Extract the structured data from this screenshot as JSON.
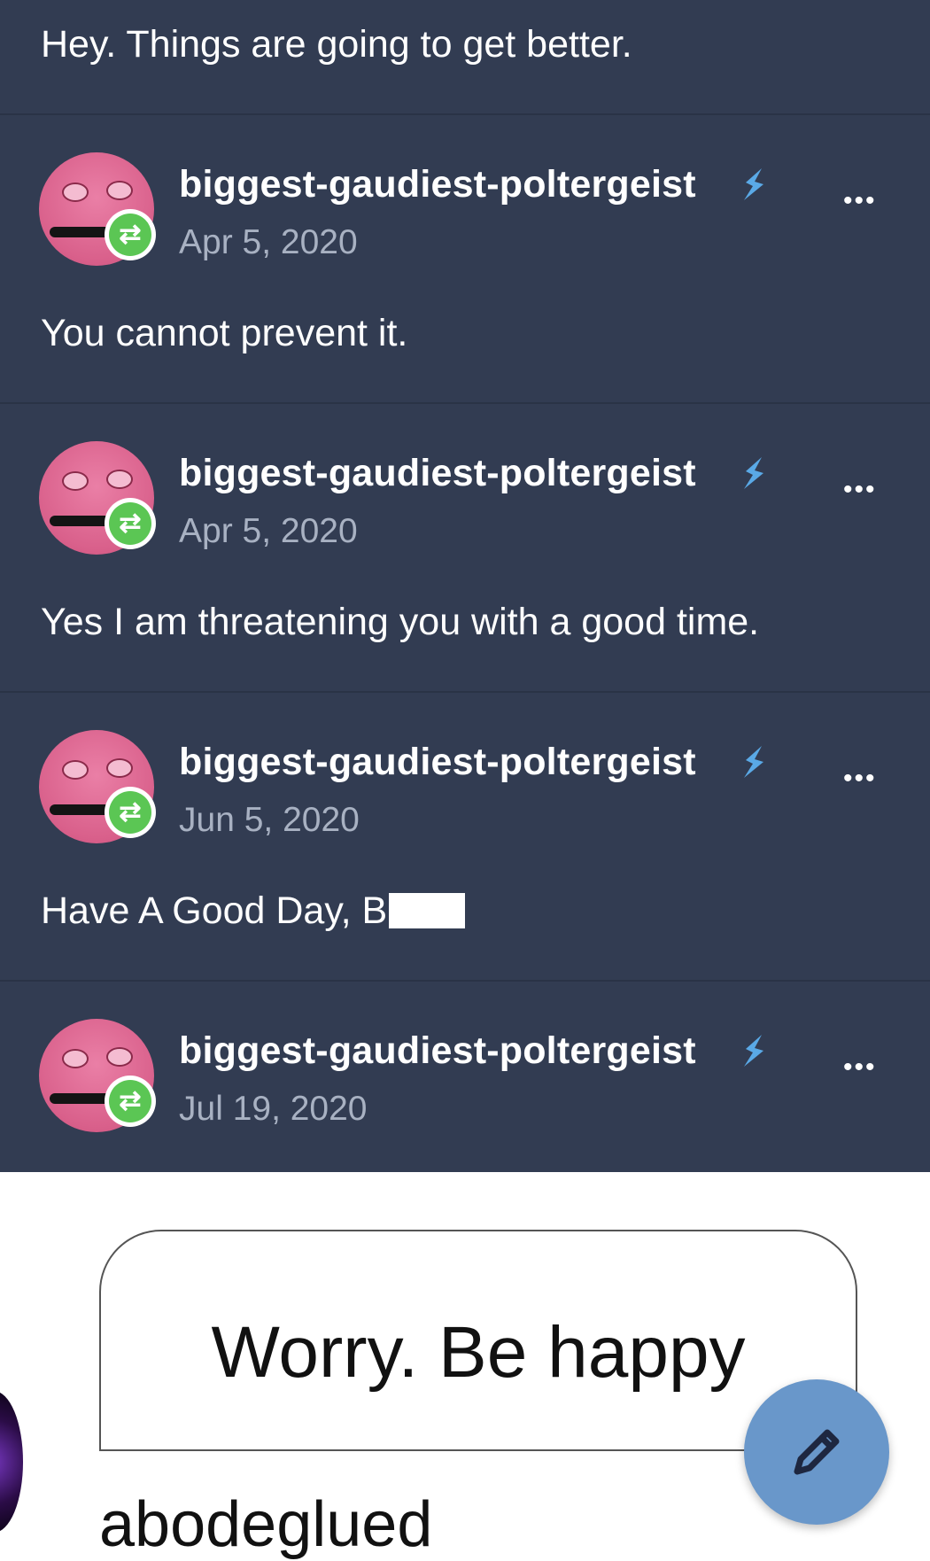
{
  "header": {
    "text": "Hey. Things are going to get better."
  },
  "posts": [
    {
      "username": "biggest-gaudiest-poltergeist",
      "date": "Apr 5, 2020",
      "text": "You cannot prevent it."
    },
    {
      "username": "biggest-gaudiest-poltergeist",
      "date": "Apr 5, 2020",
      "text": "Yes I am threatening you with a good time."
    },
    {
      "username": "biggest-gaudiest-poltergeist",
      "date": "Jun 5, 2020",
      "text": "Have A Good Day, B"
    },
    {
      "username": "biggest-gaudiest-poltergeist",
      "date": "Jul 19, 2020",
      "text": ""
    }
  ],
  "more_label": "•••",
  "reblog_icon_glyph": "⇄",
  "card": {
    "text": "Worry. Be happy"
  },
  "next_post": {
    "username": "abodeglued"
  },
  "colors": {
    "dark_bg": "#323c52",
    "reblog_green": "#5bc654",
    "verified_blue": "#5aa9e6",
    "fab_blue": "#6997ca"
  },
  "icons": {
    "reblog": "reblog-icon",
    "verified": "verified-badge-icon",
    "more": "more-options-icon",
    "compose": "pencil-icon"
  }
}
